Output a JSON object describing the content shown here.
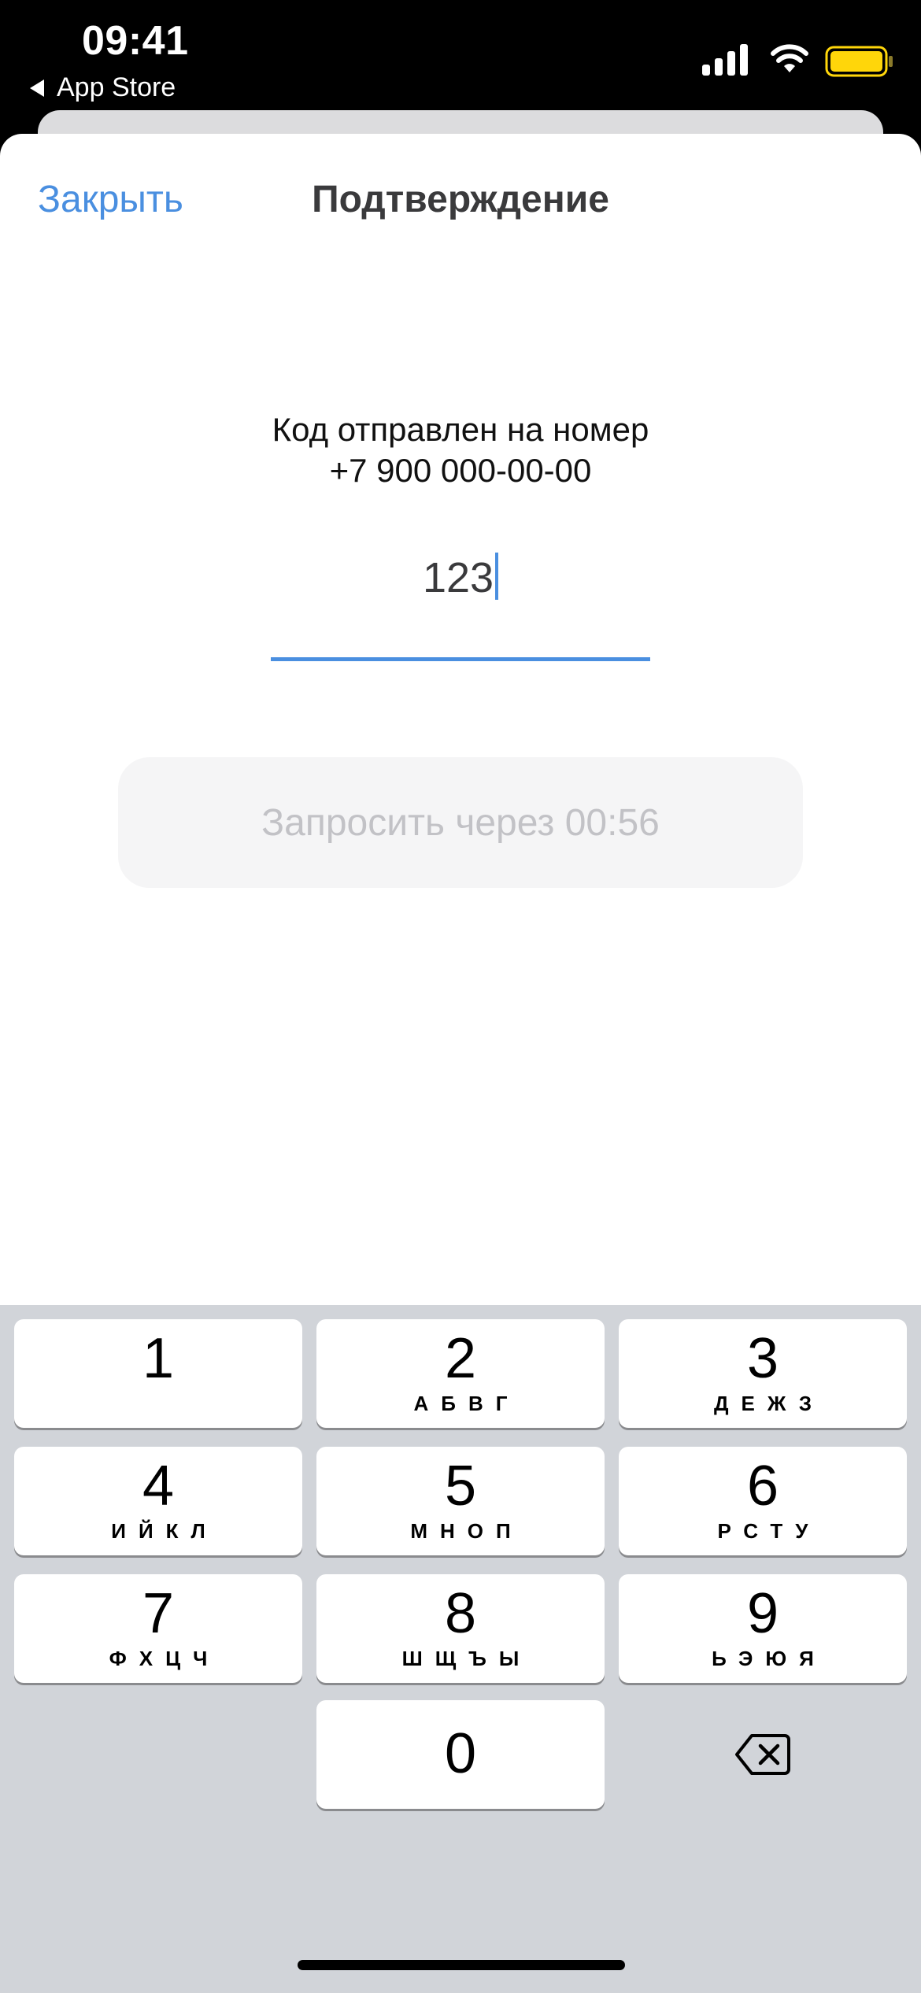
{
  "status_bar": {
    "time": "09:41",
    "back_app": "App Store",
    "battery_color": "#ffd60a"
  },
  "sheet": {
    "close_label": "Закрыть",
    "title": "Подтверждение",
    "sent_line1": "Код отправлен на номер",
    "sent_line2": "+7 900 000-00-00",
    "code_value": "123",
    "resend_label": "Запросить через 00:56",
    "accent_color": "#4a8fe0"
  },
  "keypad": {
    "keys": [
      {
        "digit": "1",
        "letters": ""
      },
      {
        "digit": "2",
        "letters": "АБВГ"
      },
      {
        "digit": "3",
        "letters": "ДЕЖЗ"
      },
      {
        "digit": "4",
        "letters": "ИЙКЛ"
      },
      {
        "digit": "5",
        "letters": "МНОП"
      },
      {
        "digit": "6",
        "letters": "РСТУ"
      },
      {
        "digit": "7",
        "letters": "ФХЦЧ"
      },
      {
        "digit": "8",
        "letters": "ШЩЪЫ"
      },
      {
        "digit": "9",
        "letters": "ЬЭЮЯ"
      },
      {
        "digit": "0",
        "letters": ""
      }
    ],
    "delete_icon": "backspace-icon"
  }
}
